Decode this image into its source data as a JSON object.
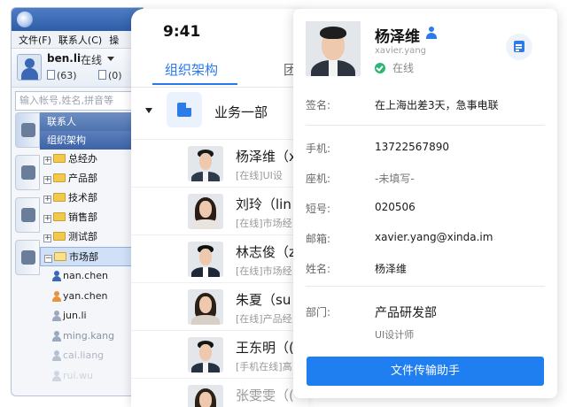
{
  "desktop": {
    "menu": [
      "文件(F)",
      "联系人(C)",
      "操"
    ],
    "user": {
      "name": "ben.li",
      "status": "在线",
      "count_a": "(63)",
      "count_b": "(0)"
    },
    "search_placeholder": "输入帐号,姓名,拼音等",
    "tabs": [
      "联系人",
      "组织架构"
    ],
    "tree": [
      {
        "label": "总经办",
        "expanded": false
      },
      {
        "label": "产品部",
        "expanded": false
      },
      {
        "label": "技术部",
        "expanded": false
      },
      {
        "label": "销售部",
        "expanded": false
      },
      {
        "label": "测试部",
        "expanded": false
      },
      {
        "label": "市场部",
        "expanded": true
      }
    ],
    "members": [
      {
        "name": "nan.chen",
        "color": "#3b67b5"
      },
      {
        "name": "yan.chen",
        "color": "#e8923a"
      },
      {
        "name": "jun.li",
        "color": "#9aa8bd"
      },
      {
        "name": "ming.kang",
        "color": "#9aa8bd"
      },
      {
        "name": "cai.liang",
        "color": "#b6c0cf"
      },
      {
        "name": "rui.wu",
        "color": "#cfd6e0"
      }
    ]
  },
  "mobile": {
    "time": "9:41",
    "tab_active": "组织架构",
    "tab_other": "团",
    "dept": "业务一部",
    "contacts": [
      {
        "name": "杨泽维（x",
        "status": "[在线]UI设",
        "gender": "m"
      },
      {
        "name": "刘玲（lin",
        "status": "[在线]市场经",
        "gender": "f"
      },
      {
        "name": "林志俊（z",
        "status": "[在线]市场经",
        "gender": "m"
      },
      {
        "name": "朱夏（su",
        "status": "[在线]产品经",
        "gender": "f"
      },
      {
        "name": "王东明（(",
        "status": "[手机在线]高",
        "gender": "m"
      },
      {
        "name": "张雯雯（(",
        "status": "",
        "gender": "f"
      }
    ]
  },
  "profile": {
    "name": "杨泽维",
    "account": "xavier.yang",
    "status": "在线",
    "signature_label": "签名:",
    "signature": "在上海出差3天，急事电联",
    "fields": [
      {
        "label": "手机:",
        "value": "13722567890"
      },
      {
        "label": "座机:",
        "value": "-未填写-"
      },
      {
        "label": "短号:",
        "value": "020506"
      },
      {
        "label": "邮箱:",
        "value": "xavier.yang@xinda.im"
      },
      {
        "label": "姓名:",
        "value": "杨泽维"
      }
    ],
    "dept_label": "部门:",
    "dept": "产品研发部",
    "job": "UI设计师",
    "button": "文件传输助手",
    "accent": "#1f7ef0",
    "online_color": "#2bb673"
  }
}
